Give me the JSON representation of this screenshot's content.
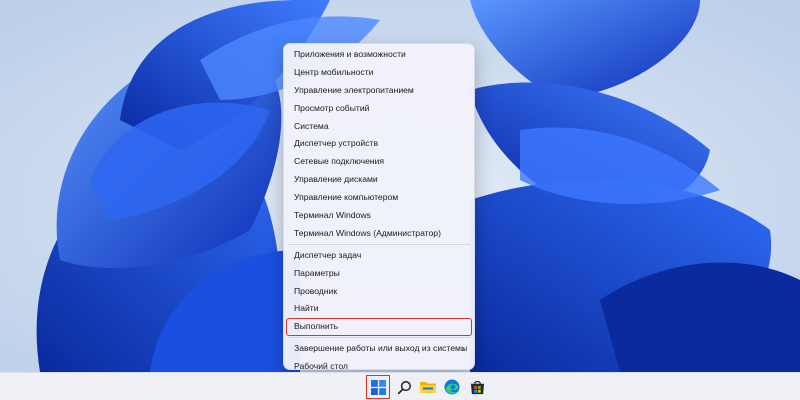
{
  "context_menu": {
    "items": [
      {
        "label": "Приложения и возможности"
      },
      {
        "label": "Центр мобильности"
      },
      {
        "label": "Управление электропитанием"
      },
      {
        "label": "Просмотр событий"
      },
      {
        "label": "Система"
      },
      {
        "label": "Диспетчер устройств"
      },
      {
        "label": "Сетевые подключения"
      },
      {
        "label": "Управление дисками"
      },
      {
        "label": "Управление компьютером"
      },
      {
        "label": "Терминал Windows"
      },
      {
        "label": "Терминал Windows (Администратор)"
      },
      {
        "label": "Диспетчер задач"
      },
      {
        "label": "Параметры"
      },
      {
        "label": "Проводник"
      },
      {
        "label": "Найти"
      },
      {
        "label": "Выполнить",
        "highlighted": true
      },
      {
        "label": "Завершение работы или выход из системы",
        "submenu": true
      },
      {
        "label": "Рабочий стол"
      }
    ]
  },
  "taskbar": {
    "icons": [
      "windows-start-icon",
      "search-icon",
      "file-explorer-icon",
      "edge-icon",
      "store-icon"
    ]
  },
  "colors": {
    "highlight": "#e0312b",
    "wallpaper_bg": "#c9d9ee",
    "bloom_dark": "#0a2fb8",
    "bloom_mid": "#1a56ea",
    "bloom_light": "#4f8cff"
  }
}
